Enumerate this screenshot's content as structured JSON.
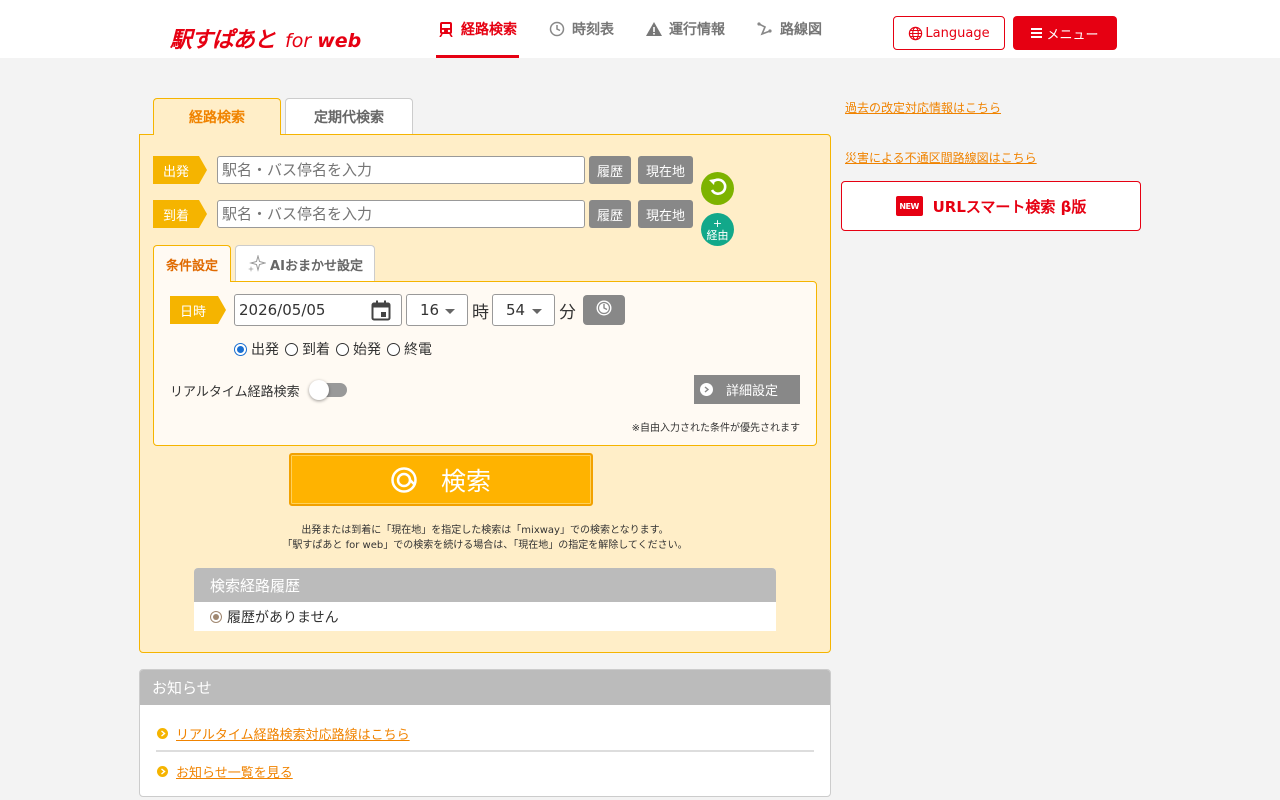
{
  "header": {
    "logo_main": "駅すぱあと",
    "logo_for": "for",
    "logo_web": "web",
    "nav": [
      {
        "label": "経路検索",
        "icon": "train-icon",
        "active": true
      },
      {
        "label": "時刻表",
        "icon": "clock-icon",
        "active": false
      },
      {
        "label": "運行情報",
        "icon": "warning-icon",
        "active": false
      },
      {
        "label": "路線図",
        "icon": "route-map-icon",
        "active": false
      }
    ],
    "language_label": "Language",
    "menu_label": "メニュー"
  },
  "main_tabs": [
    {
      "label": "経路検索",
      "active": true
    },
    {
      "label": "定期代検索",
      "active": false
    }
  ],
  "route": {
    "from_label": "出発",
    "to_label": "到着",
    "from_placeholder": "駅名・バス停名を入力",
    "to_placeholder": "駅名・バス停名を入力",
    "history_label": "履歴",
    "current_location_label": "現在地",
    "via_plus": "+",
    "via_label": "経由"
  },
  "cond_tabs": [
    {
      "label": "条件設定",
      "active": true
    },
    {
      "label": "AIおまかせ設定",
      "active": false
    }
  ],
  "conditions": {
    "datetime_label": "日時",
    "date_value": "2026/05/05",
    "hour_value": "16",
    "hour_unit": "時",
    "minute_value": "54",
    "minute_unit": "分",
    "radios": [
      {
        "label": "出発",
        "checked": true
      },
      {
        "label": "到着",
        "checked": false
      },
      {
        "label": "始発",
        "checked": false
      },
      {
        "label": "終電",
        "checked": false
      }
    ],
    "realtime_label": "リアルタイム経路検索",
    "realtime_on": false,
    "detail_label": "詳細設定",
    "note": "※自由入力された条件が優先されます"
  },
  "search": {
    "button_label": "検索",
    "note_line1": "出発または到着に「現在地」を指定した検索は「mixway」での検索となります。",
    "note_line2": "「駅すぱあと for web」での検索を続ける場合は、「現在地」の指定を解除してください。"
  },
  "history": {
    "title": "検索経路履歴",
    "empty": "履歴がありません"
  },
  "news": {
    "title": "お知らせ",
    "items": [
      "リアルタイム経路検索対応路線はこちら",
      "お知らせ一覧を見る"
    ]
  },
  "side": {
    "link1": "過去の改定対応情報はこちら",
    "link2": "災害による不通区間路線図はこちら",
    "new_badge": "NEW",
    "url_search_label": "URLスマート検索 β版"
  },
  "colors": {
    "brand_red": "#e60012",
    "accent_yellow": "#f5b400",
    "link_orange": "#f08300",
    "panel_bg": "#ffeec8"
  }
}
